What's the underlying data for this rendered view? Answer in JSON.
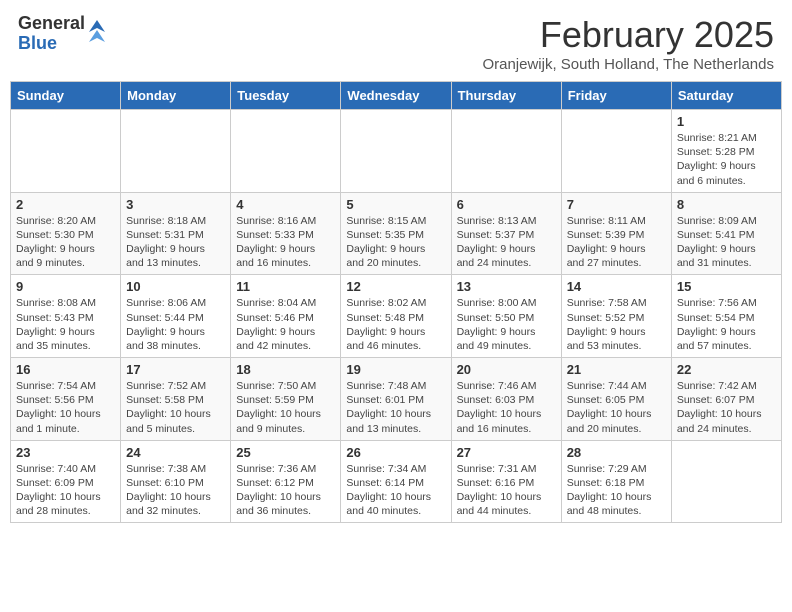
{
  "header": {
    "logo_general": "General",
    "logo_blue": "Blue",
    "month_year": "February 2025",
    "location": "Oranjewijk, South Holland, The Netherlands"
  },
  "days_of_week": [
    "Sunday",
    "Monday",
    "Tuesday",
    "Wednesday",
    "Thursday",
    "Friday",
    "Saturday"
  ],
  "weeks": [
    {
      "cells": [
        {
          "day": "",
          "text": ""
        },
        {
          "day": "",
          "text": ""
        },
        {
          "day": "",
          "text": ""
        },
        {
          "day": "",
          "text": ""
        },
        {
          "day": "",
          "text": ""
        },
        {
          "day": "",
          "text": ""
        },
        {
          "day": "1",
          "text": "Sunrise: 8:21 AM\nSunset: 5:28 PM\nDaylight: 9 hours and 6 minutes."
        }
      ]
    },
    {
      "cells": [
        {
          "day": "2",
          "text": "Sunrise: 8:20 AM\nSunset: 5:30 PM\nDaylight: 9 hours and 9 minutes."
        },
        {
          "day": "3",
          "text": "Sunrise: 8:18 AM\nSunset: 5:31 PM\nDaylight: 9 hours and 13 minutes."
        },
        {
          "day": "4",
          "text": "Sunrise: 8:16 AM\nSunset: 5:33 PM\nDaylight: 9 hours and 16 minutes."
        },
        {
          "day": "5",
          "text": "Sunrise: 8:15 AM\nSunset: 5:35 PM\nDaylight: 9 hours and 20 minutes."
        },
        {
          "day": "6",
          "text": "Sunrise: 8:13 AM\nSunset: 5:37 PM\nDaylight: 9 hours and 24 minutes."
        },
        {
          "day": "7",
          "text": "Sunrise: 8:11 AM\nSunset: 5:39 PM\nDaylight: 9 hours and 27 minutes."
        },
        {
          "day": "8",
          "text": "Sunrise: 8:09 AM\nSunset: 5:41 PM\nDaylight: 9 hours and 31 minutes."
        }
      ]
    },
    {
      "cells": [
        {
          "day": "9",
          "text": "Sunrise: 8:08 AM\nSunset: 5:43 PM\nDaylight: 9 hours and 35 minutes."
        },
        {
          "day": "10",
          "text": "Sunrise: 8:06 AM\nSunset: 5:44 PM\nDaylight: 9 hours and 38 minutes."
        },
        {
          "day": "11",
          "text": "Sunrise: 8:04 AM\nSunset: 5:46 PM\nDaylight: 9 hours and 42 minutes."
        },
        {
          "day": "12",
          "text": "Sunrise: 8:02 AM\nSunset: 5:48 PM\nDaylight: 9 hours and 46 minutes."
        },
        {
          "day": "13",
          "text": "Sunrise: 8:00 AM\nSunset: 5:50 PM\nDaylight: 9 hours and 49 minutes."
        },
        {
          "day": "14",
          "text": "Sunrise: 7:58 AM\nSunset: 5:52 PM\nDaylight: 9 hours and 53 minutes."
        },
        {
          "day": "15",
          "text": "Sunrise: 7:56 AM\nSunset: 5:54 PM\nDaylight: 9 hours and 57 minutes."
        }
      ]
    },
    {
      "cells": [
        {
          "day": "16",
          "text": "Sunrise: 7:54 AM\nSunset: 5:56 PM\nDaylight: 10 hours and 1 minute."
        },
        {
          "day": "17",
          "text": "Sunrise: 7:52 AM\nSunset: 5:58 PM\nDaylight: 10 hours and 5 minutes."
        },
        {
          "day": "18",
          "text": "Sunrise: 7:50 AM\nSunset: 5:59 PM\nDaylight: 10 hours and 9 minutes."
        },
        {
          "day": "19",
          "text": "Sunrise: 7:48 AM\nSunset: 6:01 PM\nDaylight: 10 hours and 13 minutes."
        },
        {
          "day": "20",
          "text": "Sunrise: 7:46 AM\nSunset: 6:03 PM\nDaylight: 10 hours and 16 minutes."
        },
        {
          "day": "21",
          "text": "Sunrise: 7:44 AM\nSunset: 6:05 PM\nDaylight: 10 hours and 20 minutes."
        },
        {
          "day": "22",
          "text": "Sunrise: 7:42 AM\nSunset: 6:07 PM\nDaylight: 10 hours and 24 minutes."
        }
      ]
    },
    {
      "cells": [
        {
          "day": "23",
          "text": "Sunrise: 7:40 AM\nSunset: 6:09 PM\nDaylight: 10 hours and 28 minutes."
        },
        {
          "day": "24",
          "text": "Sunrise: 7:38 AM\nSunset: 6:10 PM\nDaylight: 10 hours and 32 minutes."
        },
        {
          "day": "25",
          "text": "Sunrise: 7:36 AM\nSunset: 6:12 PM\nDaylight: 10 hours and 36 minutes."
        },
        {
          "day": "26",
          "text": "Sunrise: 7:34 AM\nSunset: 6:14 PM\nDaylight: 10 hours and 40 minutes."
        },
        {
          "day": "27",
          "text": "Sunrise: 7:31 AM\nSunset: 6:16 PM\nDaylight: 10 hours and 44 minutes."
        },
        {
          "day": "28",
          "text": "Sunrise: 7:29 AM\nSunset: 6:18 PM\nDaylight: 10 hours and 48 minutes."
        },
        {
          "day": "",
          "text": ""
        }
      ]
    }
  ]
}
